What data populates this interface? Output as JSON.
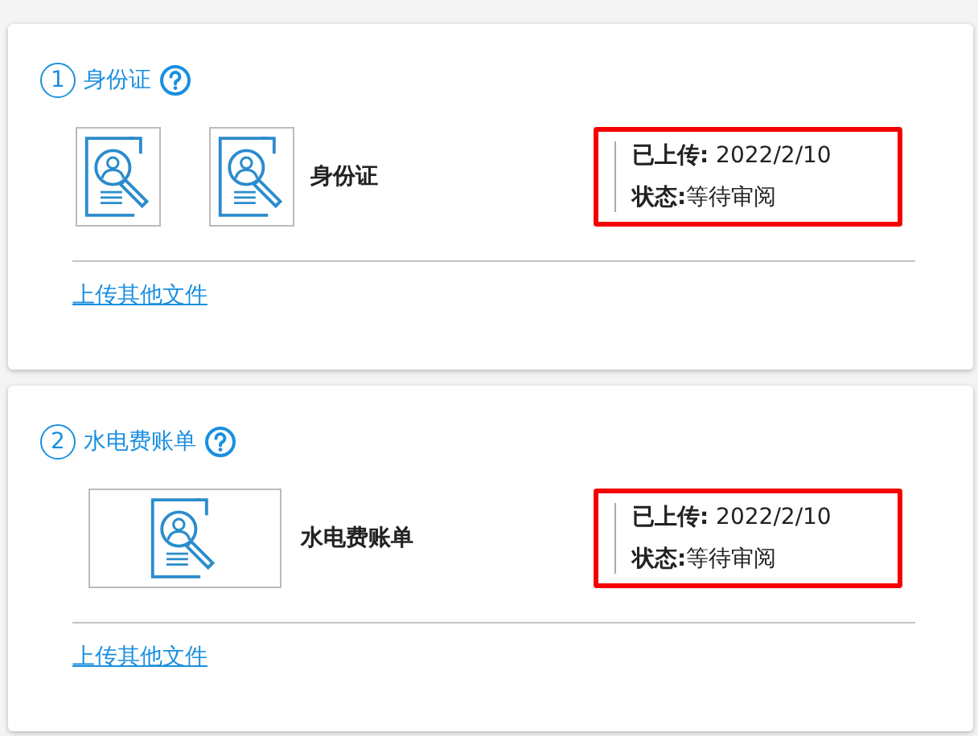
{
  "sections": [
    {
      "number": "1",
      "title": "身份证",
      "thumbnails": [
        {
          "kind": "square"
        },
        {
          "kind": "square"
        }
      ],
      "document_label": "身份证",
      "upload_line": "**已上传:** 2022/2/10",
      "status_line": "**状态:**等待审阅",
      "highlighted": true,
      "link": "上传其他文件"
    },
    {
      "number": "2",
      "title": "水电费账单",
      "thumbnails": [
        {
          "kind": "wide"
        }
      ],
      "document_label": "水电费账单",
      "upload_line": "**已上传:** 2022/2/10",
      "status_line": "**状态:**等待审阅",
      "highlighted": true,
      "link": "上传其他文件"
    }
  ]
}
